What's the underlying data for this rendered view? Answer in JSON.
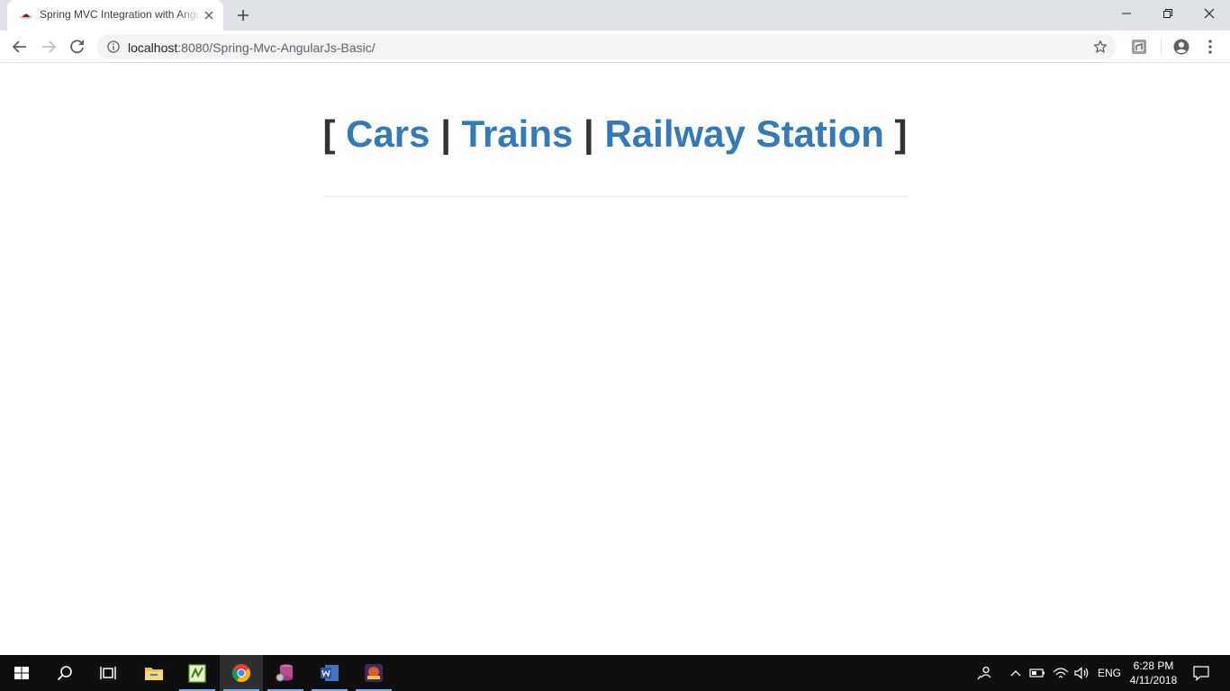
{
  "browser": {
    "tab_title": "Spring MVC Integration with AngularJs",
    "url_host": "localhost",
    "url_path": ":8080/Spring-Mvc-AngularJs-Basic/"
  },
  "page": {
    "open_bracket": "[",
    "separator": "|",
    "close_bracket": "]",
    "links": [
      "Cars",
      "Trains",
      "Railway Station"
    ],
    "link_color": "#337ab7",
    "text_color": "#333333"
  },
  "taskbar": {
    "apps": [
      "start-icon",
      "search-icon",
      "task-view-icon",
      "file-explorer-icon",
      "notepad-plus-icon",
      "chrome-icon",
      "database-tool-icon",
      "word-icon",
      "game-icon"
    ],
    "language": "ENG",
    "time": "6:28 PM",
    "date": "4/11/2018"
  }
}
